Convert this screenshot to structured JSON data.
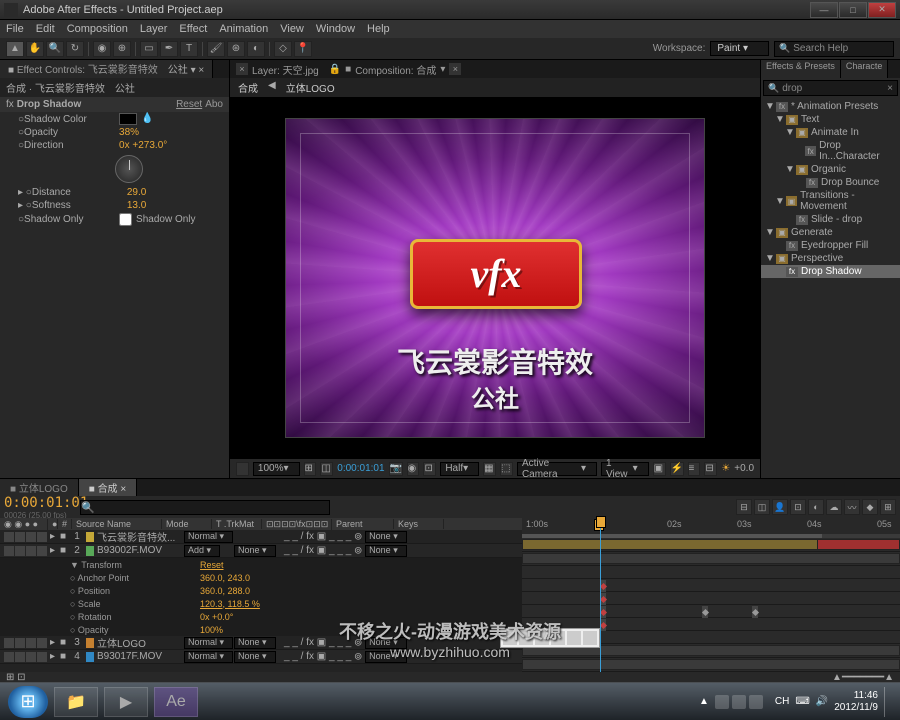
{
  "window": {
    "title": "Adobe After Effects - Untitled Project.aep"
  },
  "menu": [
    "File",
    "Edit",
    "Composition",
    "Layer",
    "Effect",
    "Animation",
    "View",
    "Window",
    "Help"
  ],
  "workspace": {
    "label": "Workspace:",
    "value": "Paint"
  },
  "search_help": "Search Help",
  "effect_controls": {
    "tab": "Effect Controls: 飞云裳影音特效",
    "tab_suffix": "公社",
    "breadcrumb": "合成 · 飞云裳影音特效　公社",
    "effect_name": "Drop Shadow",
    "reset": "Reset",
    "about": "Abo",
    "props": {
      "shadow_color": "Shadow Color",
      "opacity": "Opacity",
      "opacity_val": "38%",
      "direction": "Direction",
      "direction_val": "0x +273.0°",
      "distance": "Distance",
      "distance_val": "29.0",
      "softness": "Softness",
      "softness_val": "13.0",
      "shadow_only": "Shadow Only",
      "shadow_only_val": "Shadow Only"
    }
  },
  "comp_panel": {
    "layer_tab": "Layer: 天空.jpg",
    "comp_tab": "Composition: 合成",
    "bc1": "合成",
    "bc2": "立体LOGO",
    "logo_text": "vfx",
    "line1": "飞云裳影音特效",
    "line2": "公社"
  },
  "viewer": {
    "zoom": "100%",
    "timecode": "0:00:01:01",
    "res": "Half",
    "camera": "Active Camera",
    "views": "1 View",
    "expo": "+0.0"
  },
  "effects_presets": {
    "tab1": "Effects & Presets",
    "tab2": "Characte",
    "search": "drop",
    "tree": [
      {
        "lvl": 0,
        "arrow": "▼",
        "icon": "preset",
        "label": "* Animation Presets"
      },
      {
        "lvl": 1,
        "arrow": "▼",
        "icon": "folder",
        "label": "Text"
      },
      {
        "lvl": 2,
        "arrow": "▼",
        "icon": "folder",
        "label": "Animate In"
      },
      {
        "lvl": 3,
        "arrow": "",
        "icon": "preset",
        "label": "Drop In...Character"
      },
      {
        "lvl": 2,
        "arrow": "▼",
        "icon": "folder",
        "label": "Organic"
      },
      {
        "lvl": 3,
        "arrow": "",
        "icon": "preset",
        "label": "Drop Bounce"
      },
      {
        "lvl": 1,
        "arrow": "▼",
        "icon": "folder",
        "label": "Transitions - Movement"
      },
      {
        "lvl": 2,
        "arrow": "",
        "icon": "preset",
        "label": "Slide - drop"
      },
      {
        "lvl": 0,
        "arrow": "▼",
        "icon": "folder",
        "label": "Generate"
      },
      {
        "lvl": 1,
        "arrow": "",
        "icon": "preset",
        "label": "Eyedropper Fill"
      },
      {
        "lvl": 0,
        "arrow": "▼",
        "icon": "folder",
        "label": "Perspective"
      },
      {
        "lvl": 1,
        "arrow": "",
        "icon": "preset",
        "label": "Drop Shadow",
        "sel": true
      }
    ]
  },
  "timeline": {
    "tab1": "立体LOGO",
    "tab2": "合成",
    "timecode": "0:00:01:01",
    "sub_tc": "00026 (25.00 fps)",
    "cols": {
      "av": "",
      "idx": "#",
      "src": "Source Name",
      "mode": "Mode",
      "trk": "T .TrkMat",
      "switches": "",
      "parent": "Parent",
      "keys": "Keys"
    },
    "ruler": [
      "1:00s",
      "02s",
      "03s",
      "04s",
      "05s"
    ],
    "layers": [
      {
        "idx": "1",
        "color": "c1",
        "name": "飞云裳影音特效...",
        "mode": "Normal",
        "trk": "",
        "parent": "None"
      },
      {
        "idx": "2",
        "color": "c2",
        "name": "B93002F.MOV",
        "mode": "Add",
        "trk": "None",
        "parent": "None"
      },
      {
        "idx": "3",
        "color": "c3",
        "name": "立体LOGO",
        "mode": "Normal",
        "trk": "None",
        "parent": "None"
      },
      {
        "idx": "4",
        "color": "c4",
        "name": "B93017F.MOV",
        "mode": "Normal",
        "trk": "None",
        "parent": "None"
      }
    ],
    "transform": {
      "group": "Transform",
      "group_reset": "Reset",
      "anchor": "Anchor Point",
      "anchor_val": "360.0, 243.0",
      "position": "Position",
      "position_val": "360.0, 288.0",
      "scale": "Scale",
      "scale_val": "120.3, 118.5 %",
      "rotation": "Rotation",
      "rotation_val": "0x +0.0°",
      "opacity": "Opacity",
      "opacity_val": "100%"
    }
  },
  "watermark": {
    "line1": "不移之火-动漫游戏美术资源",
    "line2": "www.byzhihuo.com"
  },
  "taskbar": {
    "time": "11:46",
    "date": "2012/11/9",
    "lang": "CH"
  }
}
